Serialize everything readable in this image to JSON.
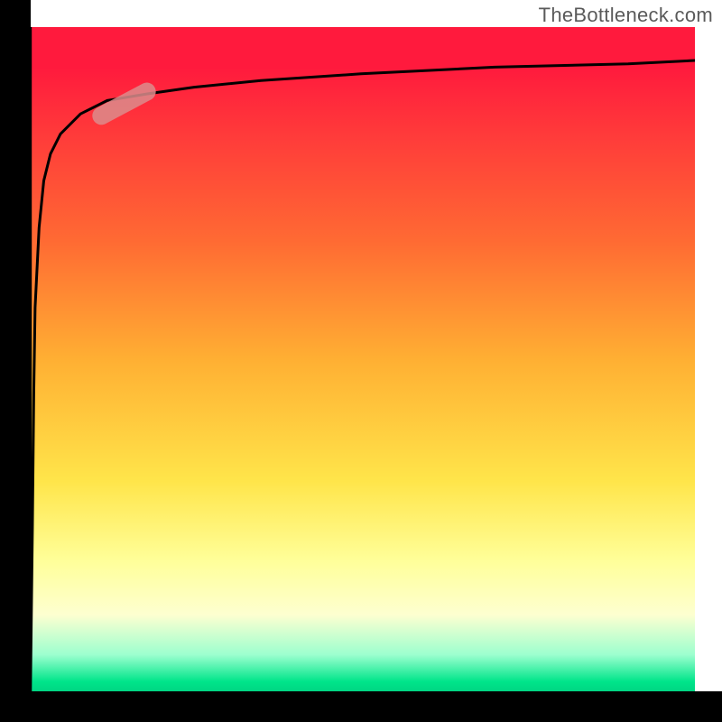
{
  "watermark": "TheBottleneck.com",
  "colors": {
    "gradient_top": "#ff1a3d",
    "gradient_mid": "#ffe54a",
    "gradient_bottom": "#00d080",
    "curve": "#000000",
    "marker": "#dc8c8c",
    "border": "#000000"
  },
  "chart_data": {
    "type": "line",
    "title": "",
    "xlabel": "",
    "ylabel": "",
    "xlim": [
      0,
      100
    ],
    "ylim": [
      0,
      100
    ],
    "grid": false,
    "legend": false,
    "series": [
      {
        "name": "curve",
        "x": [
          0.5,
          0.8,
          1.0,
          1.2,
          1.8,
          2.5,
          3.5,
          5,
          8,
          12,
          18,
          25,
          35,
          50,
          70,
          90,
          100
        ],
        "y": [
          0,
          25,
          45,
          58,
          70,
          77,
          81,
          84,
          87,
          89,
          90,
          91,
          92,
          93,
          94,
          94.5,
          95
        ]
      }
    ],
    "marker": {
      "x_range": [
        10,
        19
      ],
      "y_range": [
        86,
        91
      ],
      "angle_deg": -28
    },
    "background_gradient": [
      {
        "pos": 0.0,
        "color": "#ff1a3d"
      },
      {
        "pos": 0.06,
        "color": "#ff1a3d"
      },
      {
        "pos": 0.16,
        "color": "#ff3a3a"
      },
      {
        "pos": 0.32,
        "color": "#ff6a33"
      },
      {
        "pos": 0.5,
        "color": "#ffb033"
      },
      {
        "pos": 0.68,
        "color": "#ffe54a"
      },
      {
        "pos": 0.8,
        "color": "#ffff9a"
      },
      {
        "pos": 0.88,
        "color": "#fdffd0"
      },
      {
        "pos": 0.94,
        "color": "#9cffcf"
      },
      {
        "pos": 0.98,
        "color": "#00e58a"
      },
      {
        "pos": 1.0,
        "color": "#00d080"
      }
    ]
  }
}
